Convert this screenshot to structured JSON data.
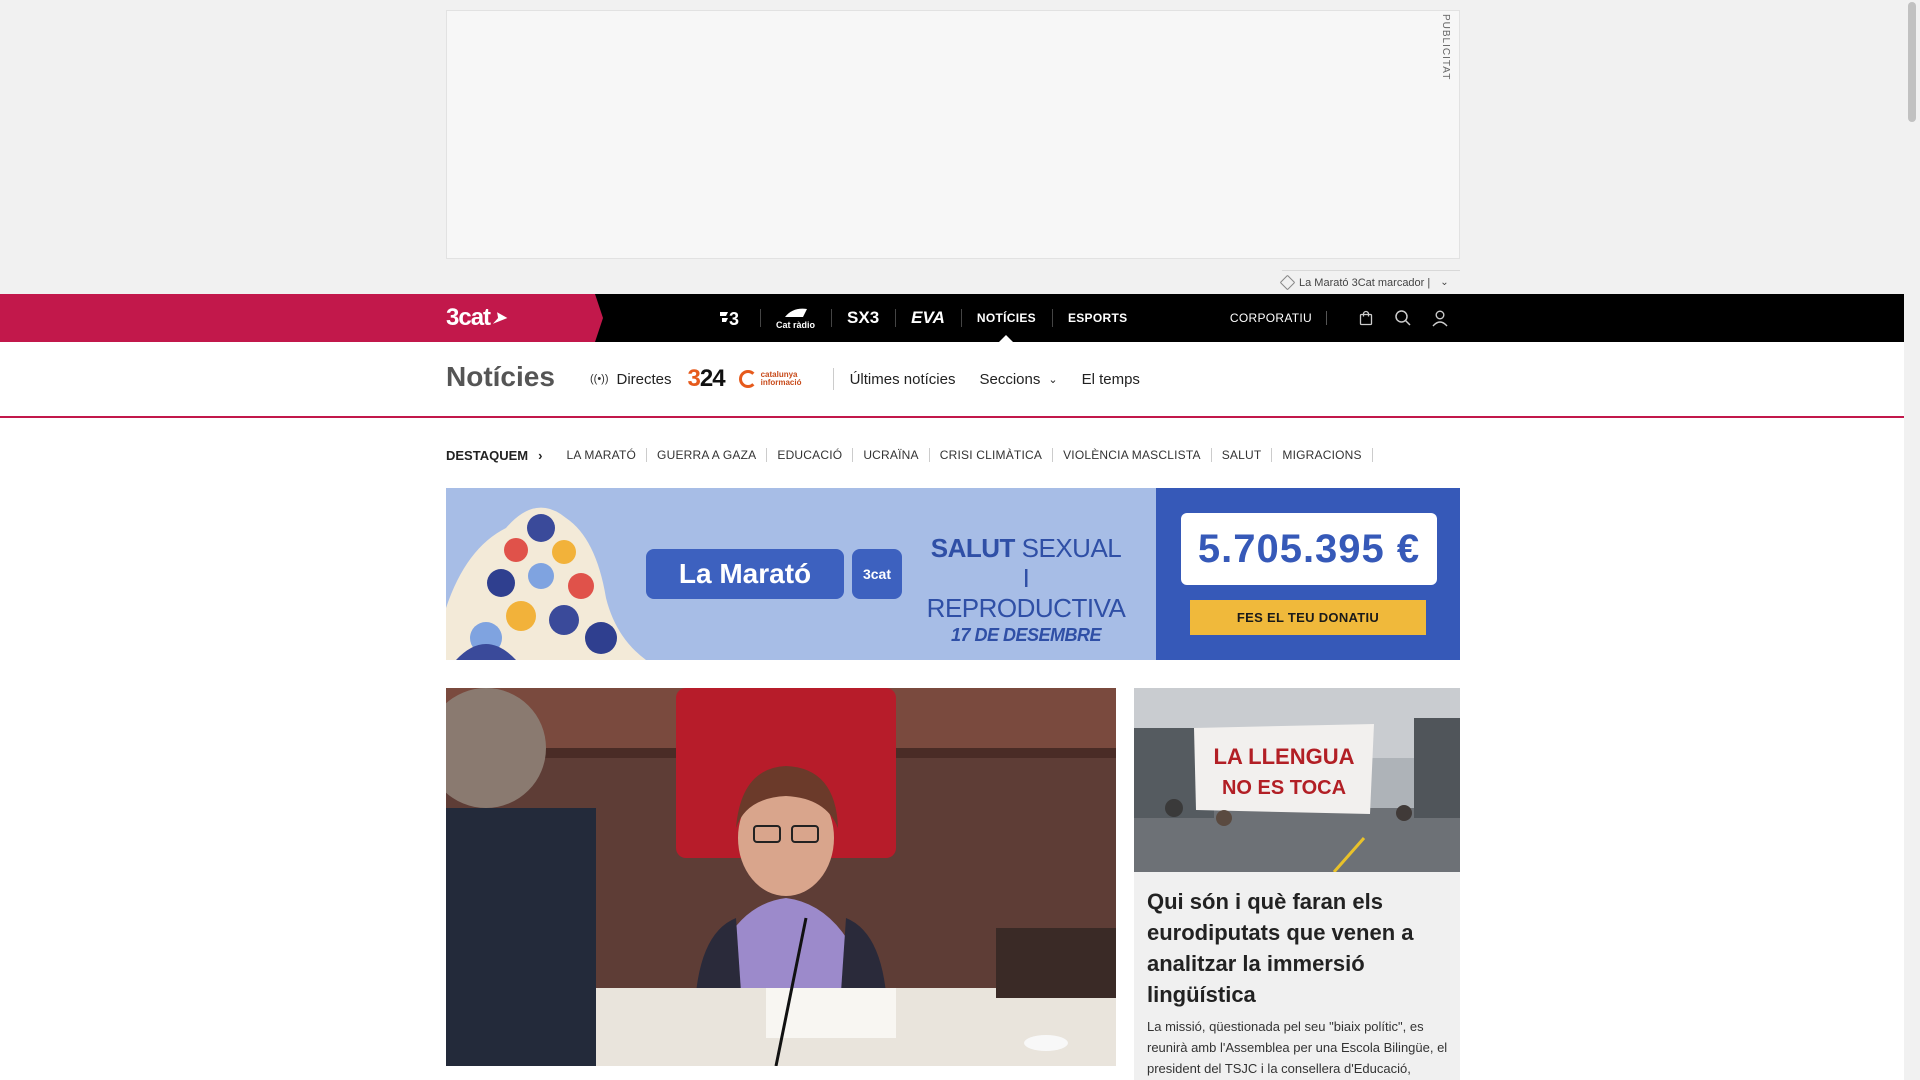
{
  "ad": {
    "label": "PUBLICITAT",
    "ticker": "La Marató 3Cat marcador |"
  },
  "topnav": {
    "brand": "3cat",
    "channels": [
      {
        "label": "3",
        "icon": "tv3-logo-icon"
      },
      {
        "label": "Cat ràdio",
        "icon": "catradio-logo-icon"
      },
      {
        "label": "SX3",
        "icon": "sx3-logo-icon"
      },
      {
        "label": "EVA",
        "icon": "eva-logo-icon"
      }
    ],
    "sections": [
      {
        "label": "NOTÍCIES",
        "active": true
      },
      {
        "label": "ESPORTS",
        "active": false
      }
    ],
    "corporate": "CORPORATIU"
  },
  "section_header": {
    "title": "Notícies",
    "directes": "Directes",
    "logo_324": {
      "three": "3",
      "rest": "24"
    },
    "logo_ci": "catalunya informació",
    "links": [
      "Últimes notícies",
      "Seccions",
      "El temps"
    ]
  },
  "destaquem": {
    "lead": "DESTAQUEM",
    "items": [
      "LA MARATÓ",
      "GUERRA A GAZA",
      "EDUCACIÓ",
      "UCRAÏNA",
      "CRISI CLIMÀTICA",
      "VIOLÈNCIA MASCLISTA",
      "SALUT",
      "MIGRACIONS"
    ]
  },
  "banner": {
    "marato": "La Marató",
    "brand": "3cat",
    "line1_bold": "SALUT",
    "line1_light": "SEXUAL",
    "line2": "I REPRODUCTIVA",
    "date": "17 DE DESEMBRE",
    "amount": "5.705.395 €",
    "cta": "FES EL TEU DONATIU"
  },
  "side_article": {
    "photo_text_1": "LA LLENGUA",
    "photo_text_2": "NO ES TOCA",
    "title": "Qui són i què faran els eurodiputats que venen a analitzar la immersió lingüística",
    "lead": "La missió, qüestionada pel seu \"biaix polític\", es reunirà amb l'Assemblea per una Escola Bilingüe, el president del TSJC i la consellera d'Educació,"
  },
  "colors": {
    "brand": "#c2184b",
    "nav_bg": "#000000",
    "banner_blue": "#3659b8",
    "banner_light": "#a7bde6",
    "cta_yellow": "#f0b93b"
  }
}
